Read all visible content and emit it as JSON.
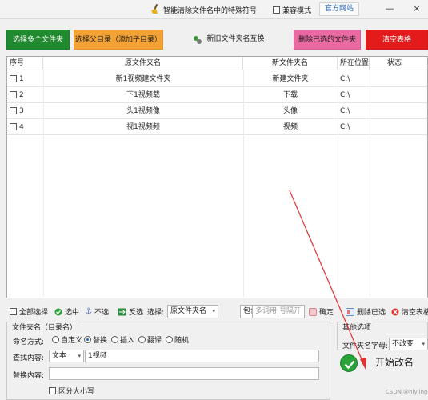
{
  "window": {
    "title": "智能清除文件名中的特殊符号",
    "compat_mode_label": "兼容模式",
    "official_site_label": "官方网站",
    "minimize": "—",
    "close": "×"
  },
  "toolbar": {
    "select_folders_label": "选择多个文件夹",
    "select_parent_label": "选择父目录（添加子目录）",
    "swap_names_label": "新旧文件夹名互换",
    "delete_selected_label": "删除已选的文件夹",
    "clear_table_label": "清空表格"
  },
  "table": {
    "columns": [
      "序号",
      "原文件夹名",
      "新文件夹名",
      "所在位置",
      "状态"
    ],
    "rows": [
      {
        "index": "1",
        "old_name": "新1视频建文件夹",
        "new_name": "新建文件夹",
        "location": "C:\\",
        "status": ""
      },
      {
        "index": "2",
        "old_name": "下1视频载",
        "new_name": "下载",
        "location": "C:\\",
        "status": ""
      },
      {
        "index": "3",
        "old_name": "头1视频像",
        "new_name": "头像",
        "location": "C:\\",
        "status": ""
      },
      {
        "index": "4",
        "old_name": "视1视频频",
        "new_name": "视频",
        "location": "C:\\",
        "status": ""
      }
    ]
  },
  "bottom_toolbar": {
    "select_all_label": "全部选择",
    "check_label": "选中",
    "uncheck_label": "不选",
    "invert_label": "反选",
    "select_label": "选择:",
    "select_field_value": "原文件夹名",
    "match_mode_value": "包含",
    "keyword_placeholder": "多词用|号隔开",
    "confirm_label": "确定",
    "delete_checked_label": "删除已选",
    "clear_table_label": "清空表格"
  },
  "rename_group": {
    "title": "文件夹名（目录名）",
    "naming_mode_label": "命名方式:",
    "modes": [
      "自定义",
      "替换",
      "插入",
      "翻译",
      "随机"
    ],
    "selected_mode": "替换",
    "find_label": "查找内容:",
    "find_type_value": "文本",
    "find_value": "1视频",
    "replace_label": "替换内容:",
    "replace_value": "",
    "case_sensitive_label": "区分大小写"
  },
  "other_options": {
    "title": "其他选项",
    "case_label": "文件夹名字母:",
    "case_value": "不改变"
  },
  "start_button_label": "开始改名",
  "watermark": "CSDN @hlyling",
  "colors": {
    "select_folders_bg": "#1f8a2e",
    "select_parent_bg": "#f3a233",
    "delete_selected_bg": "#ea69a3",
    "clear_table_bg": "#e41b1b",
    "arrow_red": "#e53030"
  }
}
